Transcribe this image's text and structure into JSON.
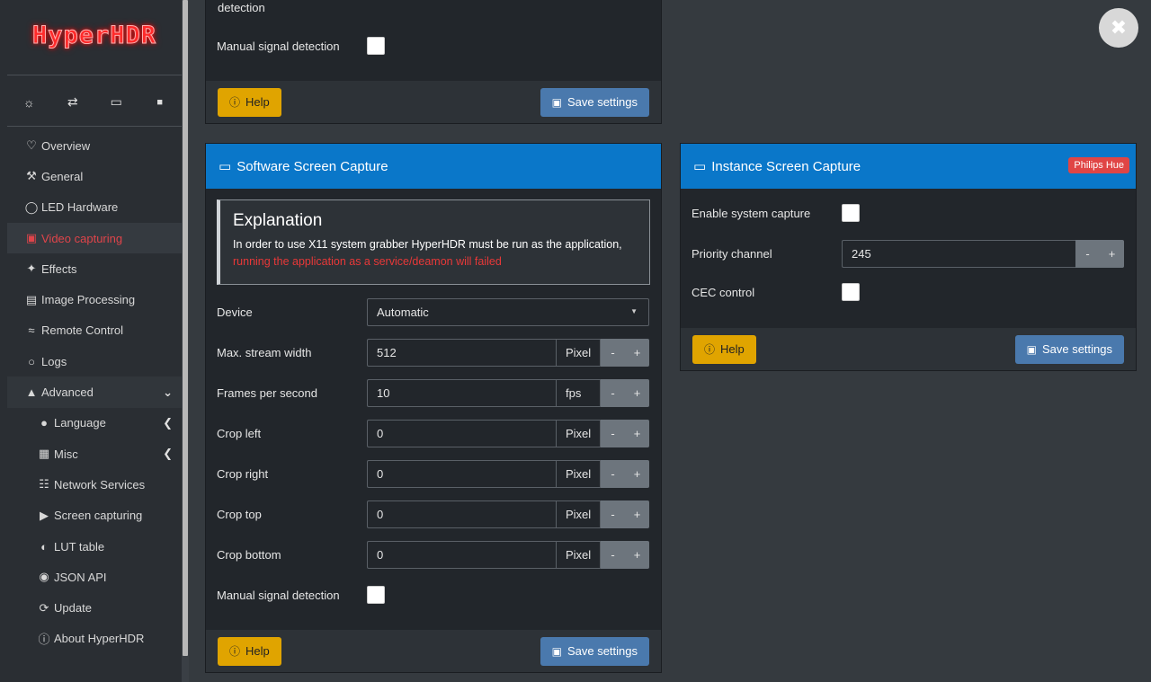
{
  "app": {
    "logo": "HyperHDR"
  },
  "top_icons": [
    {
      "name": "gear-icon",
      "glyph": "☼"
    },
    {
      "name": "swap-icon",
      "glyph": "⇄"
    },
    {
      "name": "monitor-icon",
      "glyph": "▭"
    },
    {
      "name": "lock-icon",
      "glyph": "🔒"
    }
  ],
  "sidebar": {
    "items": [
      {
        "label": "Overview",
        "icon": "♡"
      },
      {
        "label": "General",
        "icon": "🔧"
      },
      {
        "label": "LED Hardware",
        "icon": "💡"
      },
      {
        "label": "Video capturing",
        "icon": "📷"
      },
      {
        "label": "Effects",
        "icon": "✨"
      },
      {
        "label": "Image Processing",
        "icon": "🖼"
      },
      {
        "label": "Remote Control",
        "icon": "📶"
      },
      {
        "label": "Logs",
        "icon": "💬"
      },
      {
        "label": "Advanced",
        "icon": "🎓"
      }
    ],
    "sub_items": [
      {
        "label": "Language",
        "icon": "🌐"
      },
      {
        "label": "Misc",
        "icon": "📖"
      },
      {
        "label": "Network Services",
        "icon": "⛓"
      },
      {
        "label": "Screen capturing",
        "icon": "🎥"
      },
      {
        "label": "LUT table",
        "icon": "◐"
      },
      {
        "label": "JSON API",
        "icon": "◎"
      },
      {
        "label": "Update",
        "icon": "⟳"
      },
      {
        "label": "About HyperHDR",
        "icon": "ℹ"
      }
    ]
  },
  "top_panel": {
    "partial_label": "detection",
    "manual_signal_label": "Manual signal detection",
    "help_label": "Help",
    "save_label": "Save settings"
  },
  "software_capture": {
    "title": "Software Screen Capture",
    "explanation_title": "Explanation",
    "explanation_text": "In order to use X11 system grabber HyperHDR must be run as the application,",
    "explanation_warning": "running the application as a service/deamon will failed",
    "device_label": "Device",
    "device_value": "Automatic",
    "fields": [
      {
        "label": "Max. stream width",
        "value": "512",
        "unit": "Pixel"
      },
      {
        "label": "Frames per second",
        "value": "10",
        "unit": "fps"
      },
      {
        "label": "Crop left",
        "value": "0",
        "unit": "Pixel"
      },
      {
        "label": "Crop right",
        "value": "0",
        "unit": "Pixel"
      },
      {
        "label": "Crop top",
        "value": "0",
        "unit": "Pixel"
      },
      {
        "label": "Crop bottom",
        "value": "0",
        "unit": "Pixel"
      }
    ],
    "manual_signal_label": "Manual signal detection",
    "help_label": "Help",
    "save_label": "Save settings"
  },
  "instance_capture": {
    "title": "Instance Screen Capture",
    "badge": "Philips Hue",
    "enable_label": "Enable system capture",
    "priority_label": "Priority channel",
    "priority_value": "245",
    "cec_label": "CEC control",
    "help_label": "Help",
    "save_label": "Save settings"
  },
  "stepper": {
    "minus": "-",
    "plus": "+"
  },
  "colors": {
    "accent": "#0a77c9",
    "help": "#e0a400",
    "save": "#4a79ad",
    "active": "#e0444a",
    "badge": "#e04545"
  }
}
